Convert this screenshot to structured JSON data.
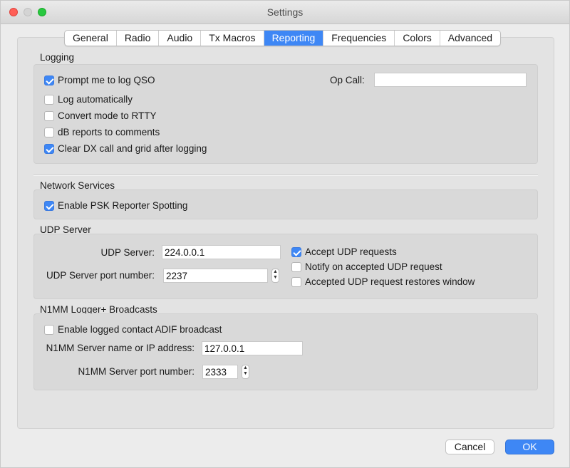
{
  "window": {
    "title": "Settings"
  },
  "tabs": [
    "General",
    "Radio",
    "Audio",
    "Tx Macros",
    "Reporting",
    "Frequencies",
    "Colors",
    "Advanced"
  ],
  "active_tab": "Reporting",
  "logging": {
    "title": "Logging",
    "prompt_log_qso": {
      "label": "Prompt me to log QSO",
      "checked": true
    },
    "log_automatically": {
      "label": "Log automatically",
      "checked": false
    },
    "convert_mode_rtty": {
      "label": "Convert mode to RTTY",
      "checked": false
    },
    "db_reports_comments": {
      "label": "dB reports to comments",
      "checked": false
    },
    "clear_dx_call": {
      "label": "Clear DX call and grid after logging",
      "checked": true
    },
    "op_call_label": "Op Call:",
    "op_call_value": ""
  },
  "network_services": {
    "title": "Network Services",
    "enable_psk": {
      "label": "Enable PSK Reporter Spotting",
      "checked": true
    }
  },
  "udp_server": {
    "title": "UDP Server",
    "server_label": "UDP Server:",
    "server_value": "224.0.0.1",
    "port_label": "UDP Server port number:",
    "port_value": "2237",
    "accept_requests": {
      "label": "Accept UDP requests",
      "checked": true
    },
    "notify_accepted": {
      "label": "Notify on accepted UDP request",
      "checked": false
    },
    "restores_window": {
      "label": "Accepted UDP request restores window",
      "checked": false
    }
  },
  "n1mm": {
    "title": "N1MM Logger+  Broadcasts",
    "enable_adif": {
      "label": "Enable logged contact ADIF broadcast",
      "checked": false
    },
    "server_label": "N1MM Server name or IP address:",
    "server_value": "127.0.0.1",
    "port_label": "N1MM Server port number:",
    "port_value": "2333"
  },
  "buttons": {
    "cancel": "Cancel",
    "ok": "OK"
  },
  "colors": {
    "accent": "#3e87f5",
    "close": "#ff5f57",
    "maximize": "#28c840"
  }
}
